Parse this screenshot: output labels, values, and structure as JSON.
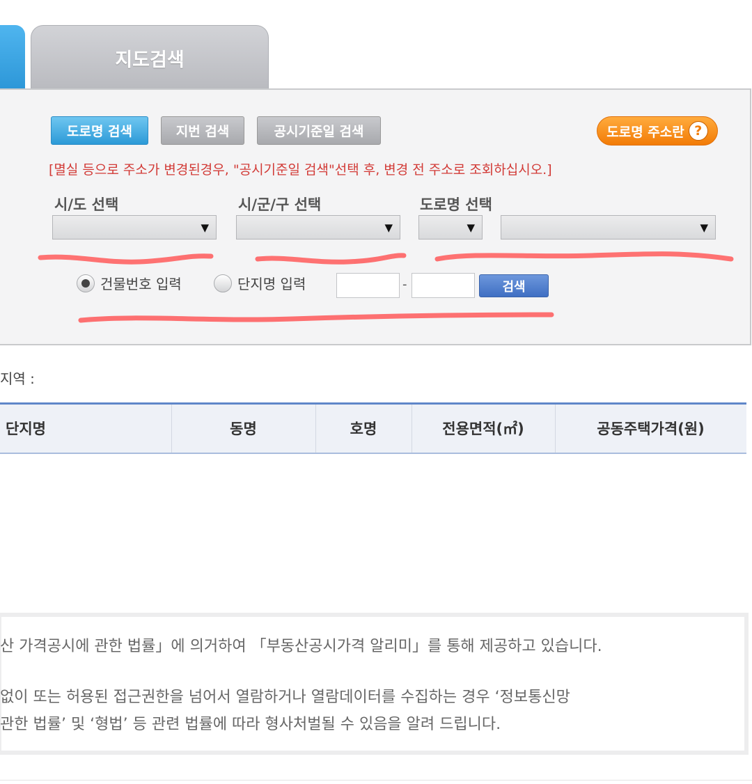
{
  "tabs": {
    "map_search": "지도검색"
  },
  "search_buttons": {
    "road": "도로명 검색",
    "lot": "지번 검색",
    "date": "공시기준일 검색",
    "guide": "도로명 주소란",
    "guide_help": "?"
  },
  "notice": "[멸실 등으로 주소가 변경된경우, \"공시기준일 검색\"선택 후, 변경 전 주소로 조회하십시오.]",
  "labels": {
    "sido": "시/도 선택",
    "sigungu": "시/군/구 선택",
    "road": "도로명 선택"
  },
  "select_arrow": "▼",
  "radios": {
    "building_no": "건물번호 입력",
    "complex_name": "단지명 입력"
  },
  "dash": "-",
  "search_label": "검색",
  "region_label": "지역 :",
  "table_headers": [
    "단지명",
    "동명",
    "호명",
    "전용면적(㎡)",
    "공동주택가격(원)"
  ],
  "info_lines": [
    "산 가격공시에 관한 법률」에 의거하여 「부동산공시가격 알리미」를 통해 제공하고 있습니다.",
    "없이 또는 허용된 접근권한을 넘어서 열람하거나 열람데이터를 수집하는 경우 ‘정보통신망",
    "관한 법률’ 및 ‘형법’ 등 관련 법률에 따라 형사처벌될 수 있음을 알려 드립니다."
  ],
  "colors": {
    "accent_blue": "#2c9ad7",
    "guide_orange": "#f27b06",
    "notice_red": "#d23a36",
    "scribble_red": "#ff5a5a"
  }
}
